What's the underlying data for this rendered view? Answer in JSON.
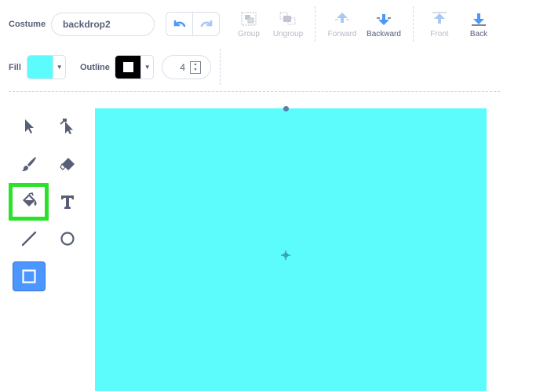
{
  "toolbar": {
    "costume_label": "Costume",
    "costume_name": "backdrop2",
    "group_label": "Group",
    "ungroup_label": "Ungroup",
    "forward_label": "Forward",
    "backward_label": "Backward",
    "front_label": "Front",
    "back_label": "Back"
  },
  "style": {
    "fill_label": "Fill",
    "fill_color": "#5cfcfc",
    "outline_label": "Outline",
    "outline_color": "#000000",
    "outline_width": "4"
  },
  "tools": {
    "selected": "rectangle",
    "highlighted": "fill",
    "highlight_color": "#2be22b",
    "accent": "#4c97ff"
  },
  "canvas": {
    "color": "#5cfcfc"
  }
}
